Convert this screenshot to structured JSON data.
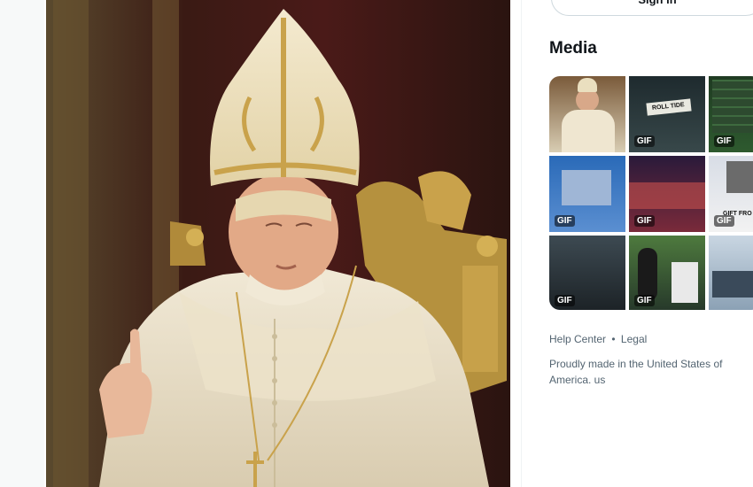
{
  "header": {
    "signin_label": "Sign in"
  },
  "media": {
    "title": "Media",
    "tiles": [
      {
        "gif": ""
      },
      {
        "gif": "GIF",
        "text": "ROLL TIDE"
      },
      {
        "gif": "GIF"
      },
      {
        "gif": "GIF"
      },
      {
        "gif": "GIF"
      },
      {
        "gif": "GIF",
        "text": "GIFT FRO"
      },
      {
        "gif": "GIF"
      },
      {
        "gif": "GIF"
      },
      {
        "gif": ""
      }
    ]
  },
  "footer": {
    "help": "Help Center",
    "sep": "•",
    "legal": "Legal",
    "made_in": "Proudly made in the United States of America. us"
  },
  "colors": {
    "accent": "#0f1419",
    "muted": "#536471",
    "border": "#cfd9de"
  }
}
